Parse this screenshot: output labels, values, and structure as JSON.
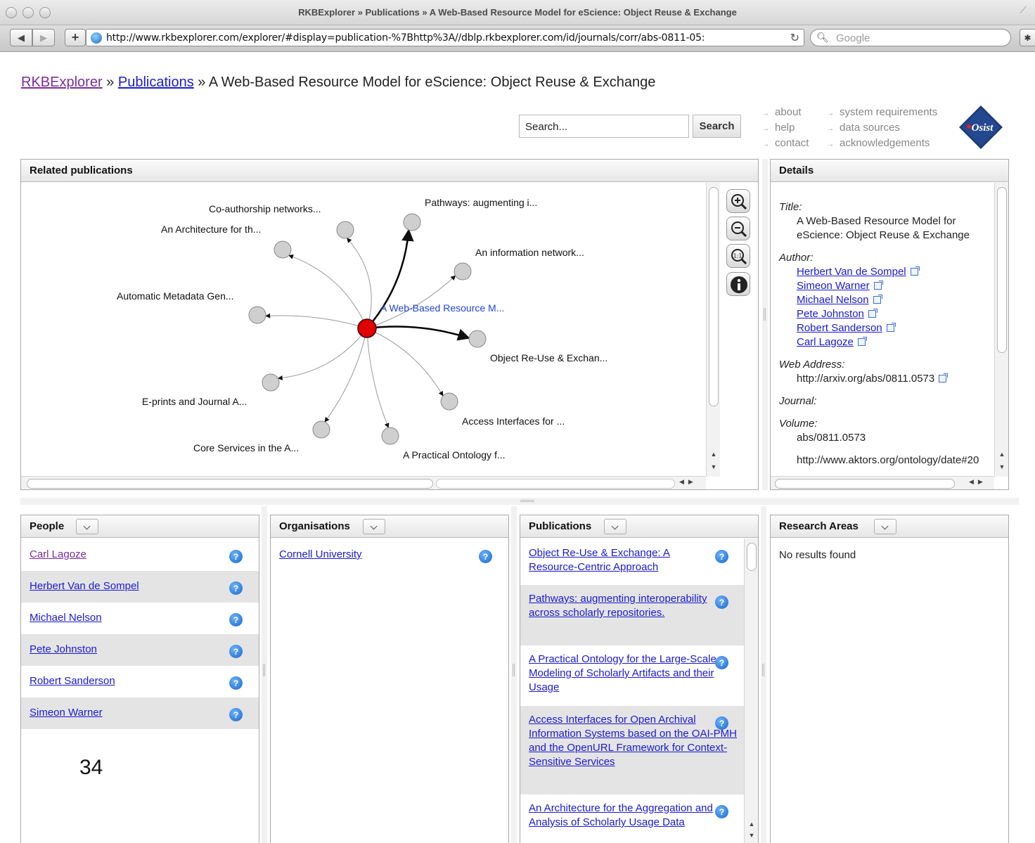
{
  "window": {
    "title": "RKBExplorer » Publications » A Web-Based Resource Model for eScience: Object Reuse & Exchange"
  },
  "browser": {
    "back_icon": "back-arrow-icon",
    "forward_icon": "forward-arrow-icon",
    "add_icon": "plus-icon",
    "url": "http://www.rkbexplorer.com/explorer/#display=publication-%7Bhttp%3A//dblp.rkbexplorer.com/id/journals/corr/abs-0811-05:",
    "reload_icon": "reload-icon",
    "search_placeholder": "Google"
  },
  "breadcrumb": {
    "home": "RKBExplorer",
    "sep1": " » ",
    "section": "Publications",
    "sep2": " » ",
    "current": "A Web-Based Resource Model for eScience: Object Reuse & Exchange"
  },
  "search": {
    "value": "Search...",
    "button": "Search"
  },
  "toplinks": {
    "col1": [
      "about",
      "help",
      "contact"
    ],
    "col2": [
      "system requirements",
      "data sources",
      "acknowledgements"
    ]
  },
  "logo": {
    "text": "Osist"
  },
  "related": {
    "title": "Related publications",
    "center_label": "A Web-Based Resource M...",
    "nodes": [
      "Co-authorship networks...",
      "Pathways: augmenting i...",
      "An Architecture for th...",
      "An information network...",
      "Automatic Metadata Gen...",
      "Object Re-Use & Exchan...",
      "E-prints and Journal A...",
      "Access Interfaces for ...",
      "Core Services in the A...",
      "A Practical Ontology f..."
    ],
    "tools": [
      "zoom-in-icon",
      "zoom-out-icon",
      "zoom-fit-icon",
      "info-icon"
    ]
  },
  "details": {
    "title": "Details",
    "title_label": "Title:",
    "title_value": "A Web-Based Resource Model for eScience: Object Reuse & Exchange",
    "author_label": "Author:",
    "authors": [
      "Herbert Van de Sompel",
      "Simeon Warner",
      "Michael Nelson",
      "Pete Johnston",
      "Robert Sanderson",
      "Carl Lagoze"
    ],
    "web_label": "Web Address:",
    "web_value": "http://arxiv.org/abs/0811.0573",
    "journal_label": "Journal:",
    "volume_label": "Volume:",
    "volume_value": "abs/0811.0573",
    "cut_line": "http://www.aktors.org/ontology/date#20"
  },
  "people": {
    "title": "People",
    "items": [
      "Carl Lagoze",
      "Herbert Van de Sompel",
      "Michael Nelson",
      "Pete Johnston",
      "Robert Sanderson",
      "Simeon Warner"
    ]
  },
  "organisations": {
    "title": "Organisations",
    "items": [
      "Cornell University"
    ]
  },
  "publications": {
    "title": "Publications",
    "items": [
      "Object Re-Use & Exchange: A Resource-Centric Approach",
      "Pathways: augmenting interoperability across scholarly repositories.",
      "A Practical Ontology for the Large-Scale Modeling of Scholarly Artifacts and their Usage",
      "Access Interfaces for Open Archival Information Systems based on the OAI-PMH and the OpenURL Framework for Context-Sensitive Services",
      "An Architecture for the Aggregation and Analysis of Scholarly Usage Data"
    ]
  },
  "research_areas": {
    "title": "Research Areas",
    "empty": "No results found"
  },
  "page_number": "34",
  "colors": {
    "link": "#1a1ad4",
    "visited": "#7a2d9a",
    "center_node": "#e00000",
    "node": "#cfcfcf",
    "row_alt": "#e4e4e4"
  }
}
